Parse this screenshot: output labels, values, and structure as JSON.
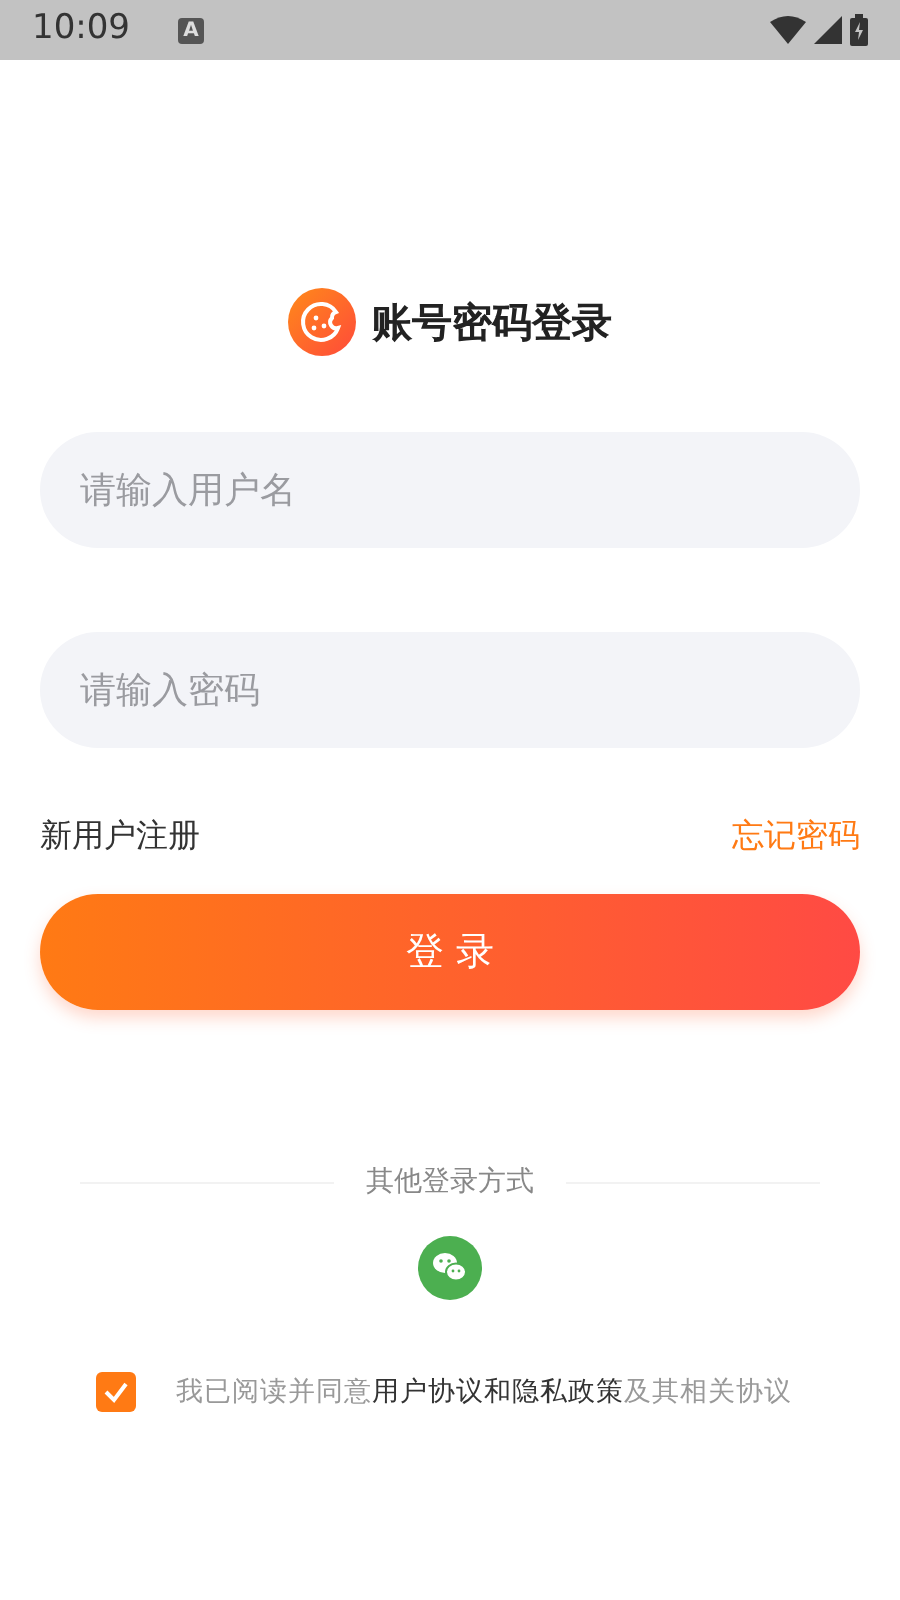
{
  "status_bar": {
    "time": "10:09",
    "notification": "A"
  },
  "title": "账号密码登录",
  "fields": [
    {
      "placeholder": "请输入用户名"
    },
    {
      "placeholder": "请输入密码"
    }
  ],
  "register_link": "新用户注册",
  "forgot_link": "忘记密码",
  "login_button": "登 录",
  "other_methods": "其他登录方式",
  "agreement": {
    "checked": true,
    "before": "我已阅读并同意",
    "link1": "用户协议",
    "joiner": "和",
    "link2": "隐私政策",
    "after": "及其相关协议"
  }
}
